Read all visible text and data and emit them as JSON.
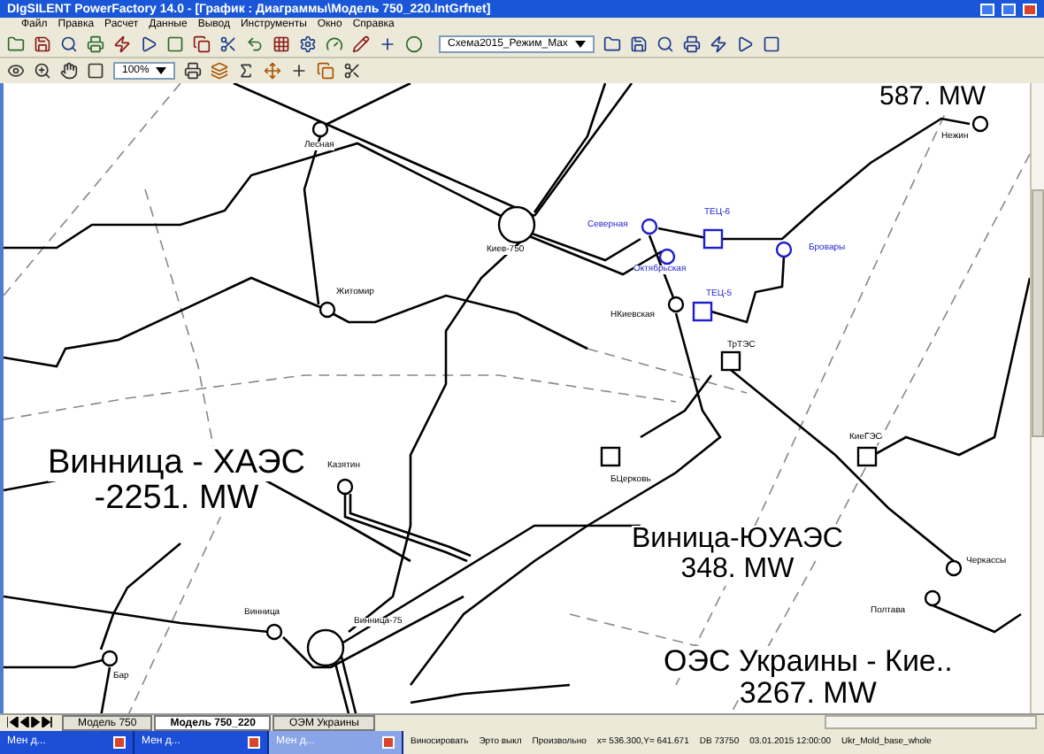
{
  "window": {
    "title": "DIgSILENT PowerFactory 14.0 - [График : Диаграммы\\Модель 750_220.IntGrfnet]"
  },
  "menu": [
    "Файл",
    "Правка",
    "Расчет",
    "Данные",
    "Вывод",
    "Инструменты",
    "Окно",
    "Справка"
  ],
  "toolbar": {
    "case_dropdown": "Схема2015_Режим_Max",
    "zoom_dropdown": "100%"
  },
  "diagram": {
    "nodes": [
      {
        "label": "Киев-750",
        "kind": "bus"
      },
      {
        "label": "Северная",
        "kind": "bus"
      },
      {
        "label": "ТЕЦ-6",
        "kind": "plant"
      },
      {
        "label": "Октябрьская",
        "kind": "bus"
      },
      {
        "label": "Бровары",
        "kind": "bus"
      },
      {
        "label": "НКиевская",
        "kind": "bus"
      },
      {
        "label": "ТЕЦ-5",
        "kind": "plant"
      },
      {
        "label": "ТрТЭС",
        "kind": "plant"
      },
      {
        "label": "Житомир",
        "kind": "bus"
      },
      {
        "label": "Лесная",
        "kind": "bus"
      },
      {
        "label": "Нежин",
        "kind": "bus"
      },
      {
        "label": "БЦерковь",
        "kind": "plant"
      },
      {
        "label": "Казятин",
        "kind": "bus"
      },
      {
        "label": "КиеГЭС",
        "kind": "plant"
      },
      {
        "label": "Черкассы",
        "kind": "bus"
      },
      {
        "label": "Полтава",
        "kind": "bus"
      },
      {
        "label": "Винница",
        "kind": "bus"
      },
      {
        "label": "Винница-75",
        "kind": "bus"
      },
      {
        "label": "Бар",
        "kind": "bus"
      }
    ],
    "flows": [
      {
        "value": "587. MW"
      },
      {
        "name": "Винница - ХАЭС",
        "value": "-2251. MW"
      },
      {
        "name": "Виница-ЮУАЭС",
        "value": "348. MW"
      },
      {
        "name": "ОЭС Украины - Кие..",
        "value": "3267. MW"
      }
    ]
  },
  "tabs": [
    {
      "label": "Модель 750",
      "selected": false
    },
    {
      "label": "Модель 750_220",
      "selected": true
    },
    {
      "label": "ОЭМ Украины",
      "selected": false
    }
  ],
  "taskbar": [
    {
      "label": "Мен д...",
      "active": true
    },
    {
      "label": "Мен д...",
      "active": true
    },
    {
      "label": "Мен д...",
      "active": false
    }
  ],
  "status_bar": [
    "Виносировать",
    "Эрто выкл",
    "Произвольно",
    "x=  536.300,Y=  641.671",
    "DB 73750",
    "03.01.2015 12:00:00",
    "Ukr_Mold_base_whole"
  ]
}
